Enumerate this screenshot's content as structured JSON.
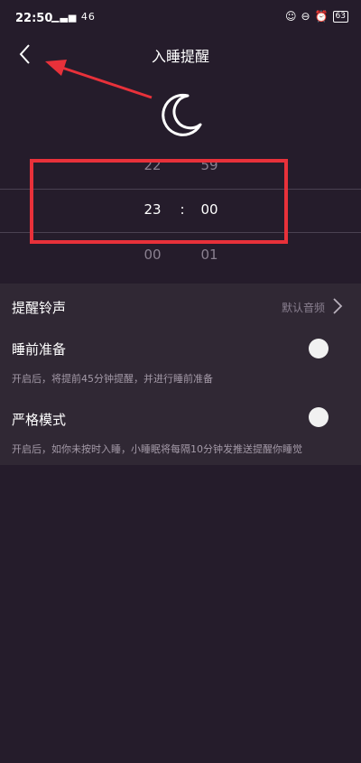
{
  "status_bar": {
    "time": "22:50",
    "signal_text": "▁▃▅ 46",
    "battery": "63"
  },
  "header": {
    "title": "入睡提醒"
  },
  "picker": {
    "hours": [
      "22",
      "23",
      "00"
    ],
    "separator": ":",
    "minutes": [
      "59",
      "00",
      "01"
    ]
  },
  "settings": {
    "ringtone": {
      "label": "提醒铃声",
      "value": "默认音频"
    },
    "bedtime_prep": {
      "label": "睡前准备",
      "desc": "开启后，将提前45分钟提醒，并进行睡前准备",
      "enabled": false
    },
    "strict_mode": {
      "label": "严格模式",
      "desc": "开启后，如你未按时入睡，小睡眠将每隔10分钟发推送提醒你睡觉",
      "enabled": false
    }
  },
  "colors": {
    "background": "#251c2b",
    "panel": "#302834",
    "annotation_red": "#e8313a"
  }
}
